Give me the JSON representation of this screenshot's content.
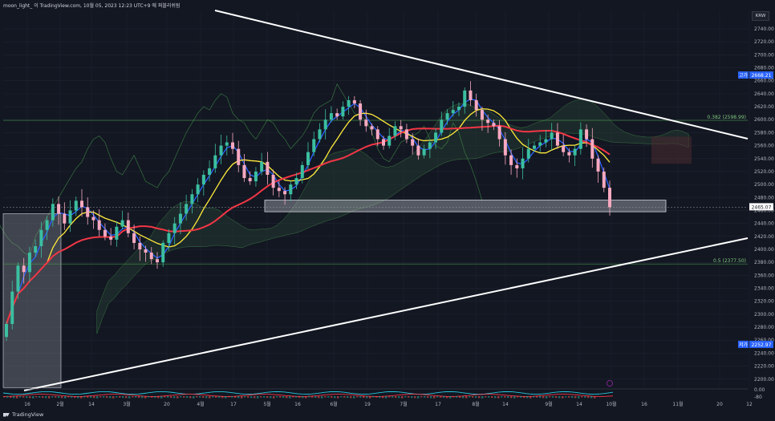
{
  "header": {
    "text": "moon_light_ 이 TradingView.com, 10월 05, 2023 12:23 UTC+9 에 퍼블리쉬됨"
  },
  "footer": {
    "brand": "TradingView"
  },
  "currency": "KRW",
  "chart_data": {
    "type": "candlestick",
    "price_axis": [
      2200,
      2220,
      2240,
      2260,
      2280,
      2300,
      2320,
      2340,
      2360,
      2380,
      2400,
      2420,
      2440,
      2460,
      2480,
      2500,
      2520,
      2540,
      2560,
      2580,
      2600,
      2620,
      2640,
      2660,
      2680,
      2700,
      2720,
      2740
    ],
    "ylim": [
      2186,
      2752
    ],
    "time_labels": [
      "16",
      "2월",
      "14",
      "3월",
      "20",
      "4월",
      "17",
      "5월",
      "16",
      "6월",
      "19",
      "7월",
      "17",
      "8월",
      "14",
      "9월",
      "14",
      "10월",
      "16",
      "11월",
      "20",
      "12"
    ],
    "badges": {
      "high": {
        "label": "고가",
        "value": "2668.21"
      },
      "current": {
        "value": "2465.07"
      },
      "low": {
        "label": "저가",
        "value": "2252.97"
      }
    },
    "fib": [
      {
        "label": "0.382 (2598.99)",
        "value": 2598.99
      },
      {
        "label": "0.5 (2377.50)",
        "value": 2377.5
      }
    ],
    "closes": [
      2285,
      2335,
      2375,
      2365,
      2395,
      2405,
      2430,
      2445,
      2470,
      2455,
      2440,
      2460,
      2475,
      2465,
      2450,
      2445,
      2430,
      2420,
      2415,
      2435,
      2445,
      2425,
      2410,
      2400,
      2395,
      2385,
      2380,
      2410,
      2425,
      2440,
      2455,
      2470,
      2485,
      2500,
      2515,
      2525,
      2545,
      2560,
      2565,
      2555,
      2530,
      2510,
      2505,
      2520,
      2535,
      2515,
      2495,
      2490,
      2485,
      2500,
      2510,
      2530,
      2550,
      2570,
      2585,
      2600,
      2610,
      2605,
      2620,
      2630,
      2625,
      2600,
      2590,
      2585,
      2570,
      2560,
      2575,
      2590,
      2585,
      2570,
      2560,
      2545,
      2555,
      2565,
      2580,
      2600,
      2610,
      2615,
      2620,
      2645,
      2630,
      2615,
      2600,
      2595,
      2590,
      2570,
      2545,
      2530,
      2525,
      2540,
      2555,
      2560,
      2565,
      2570,
      2580,
      2560,
      2550,
      2545,
      2555,
      2585,
      2570,
      2540,
      2520,
      2495,
      2465
    ],
    "zones": [
      {
        "name": "support-box",
        "from_bar": 47,
        "to_bar": 123,
        "top": 2476,
        "bottom": 2458
      }
    ]
  }
}
